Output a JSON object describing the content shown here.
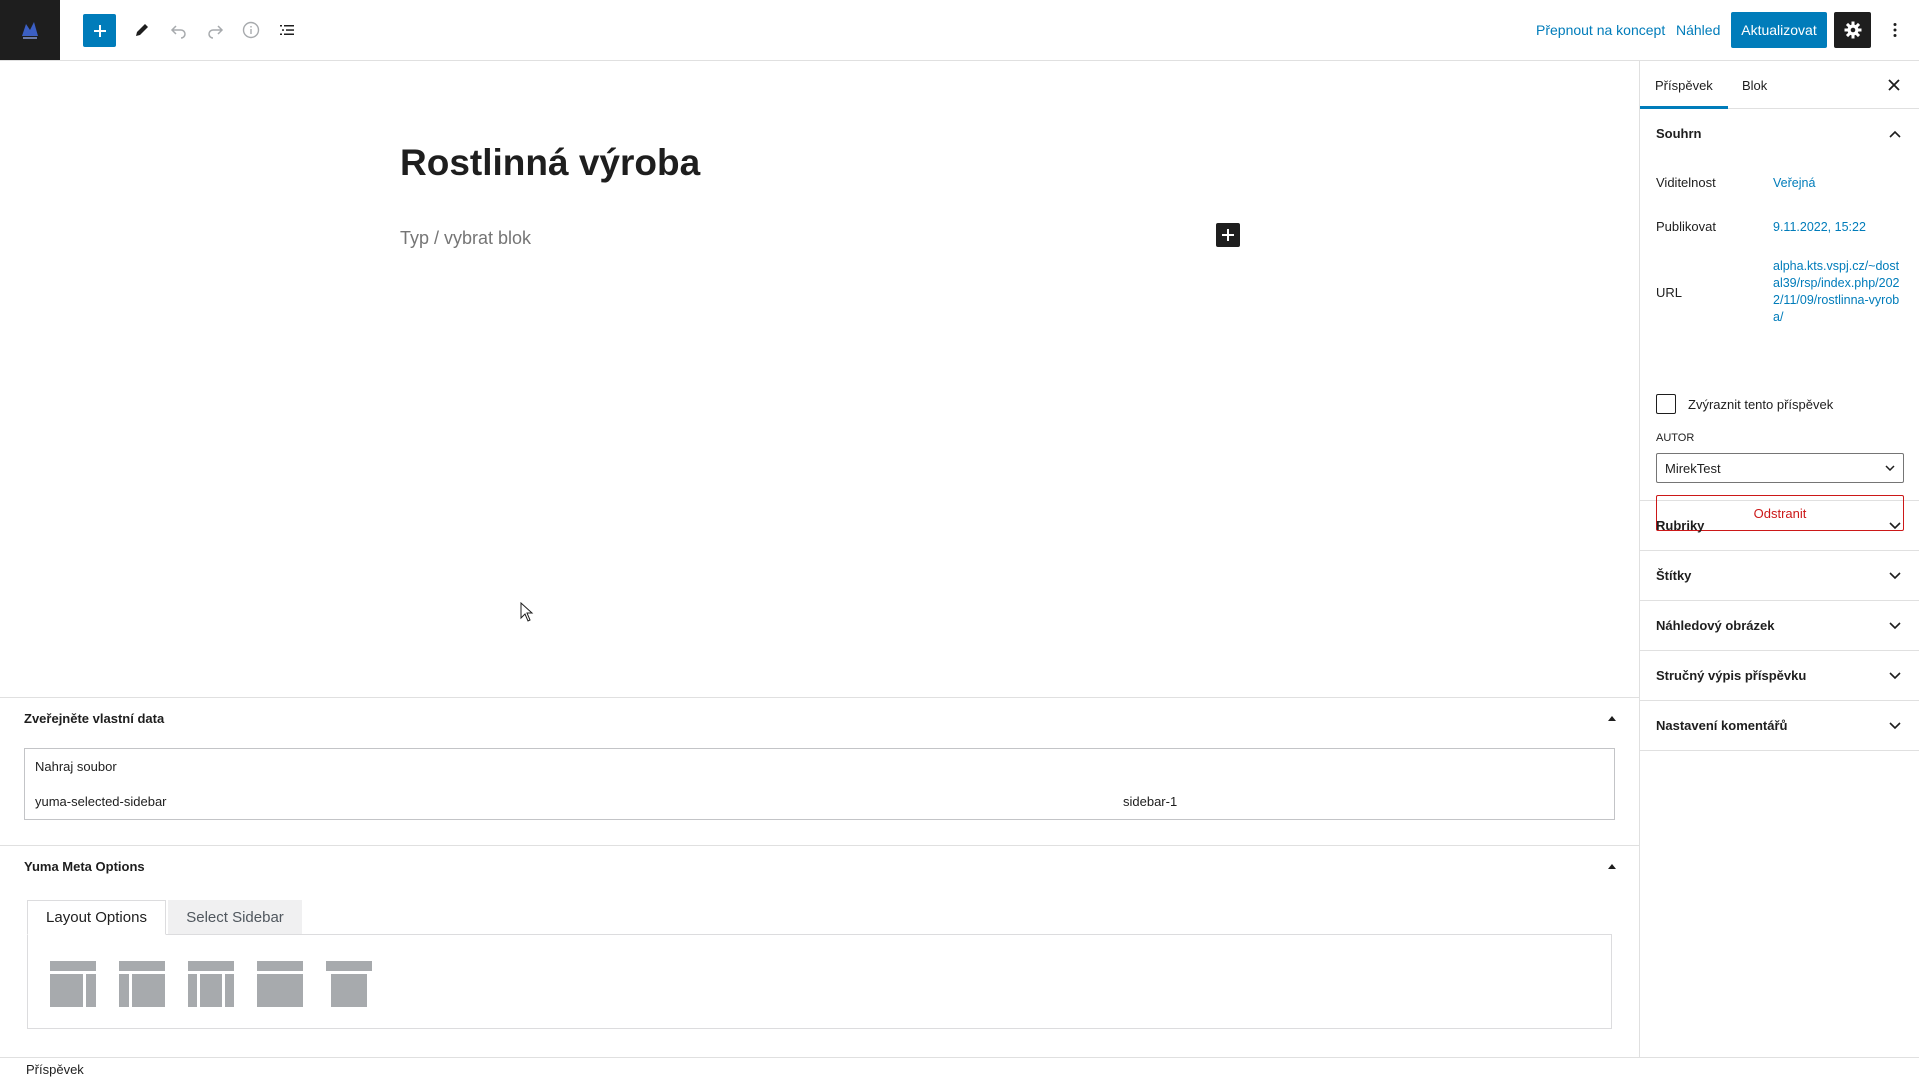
{
  "toolbar": {
    "switch_to_draft": "Přepnout na koncept",
    "preview": "Náhled",
    "update": "Aktualizovat"
  },
  "editor": {
    "title": "Rostlinná výroba",
    "placeholder": "Typ / vybrat blok"
  },
  "custom_fields_box": {
    "title": "Zveřejněte vlastní data",
    "upload_label": "Nahraj soubor",
    "rows": [
      {
        "key": "yuma-selected-sidebar",
        "value": "sidebar-1"
      }
    ]
  },
  "yuma_box": {
    "title": "Yuma Meta Options",
    "tabs": [
      "Layout Options",
      "Select Sidebar"
    ],
    "layout_options": [
      "left-sidebar",
      "right-sidebar",
      "both-sidebars",
      "full-width",
      "no-sidebar-centered"
    ]
  },
  "footer": {
    "breadcrumb": "Příspěvek"
  },
  "sidebar": {
    "tabs": [
      "Příspěvek",
      "Blok"
    ],
    "summary": {
      "title": "Souhrn",
      "visibility_label": "Viditelnost",
      "visibility_value": "Veřejná",
      "publish_label": "Publikovat",
      "publish_value": "9.11.2022, 15:22",
      "url_label": "URL",
      "url_value": "alpha.kts.vspj.cz/~dostal39/rsp/index.php/2022/11/09/rostlinna-vyroba/",
      "sticky_label": "Zvýraznit tento příspěvek",
      "author_label": "Autor",
      "author_value": "MirekTest",
      "delete_label": "Odstranit"
    },
    "panels": [
      "Rubriky",
      "Štítky",
      "Náhledový obrázek",
      "Stručný výpis příspěvku",
      "Nastavení komentářů"
    ]
  },
  "colors": {
    "accent": "#007cba",
    "dark": "#1e1e1e",
    "danger": "#cc1818",
    "border": "#e0e0e0"
  }
}
